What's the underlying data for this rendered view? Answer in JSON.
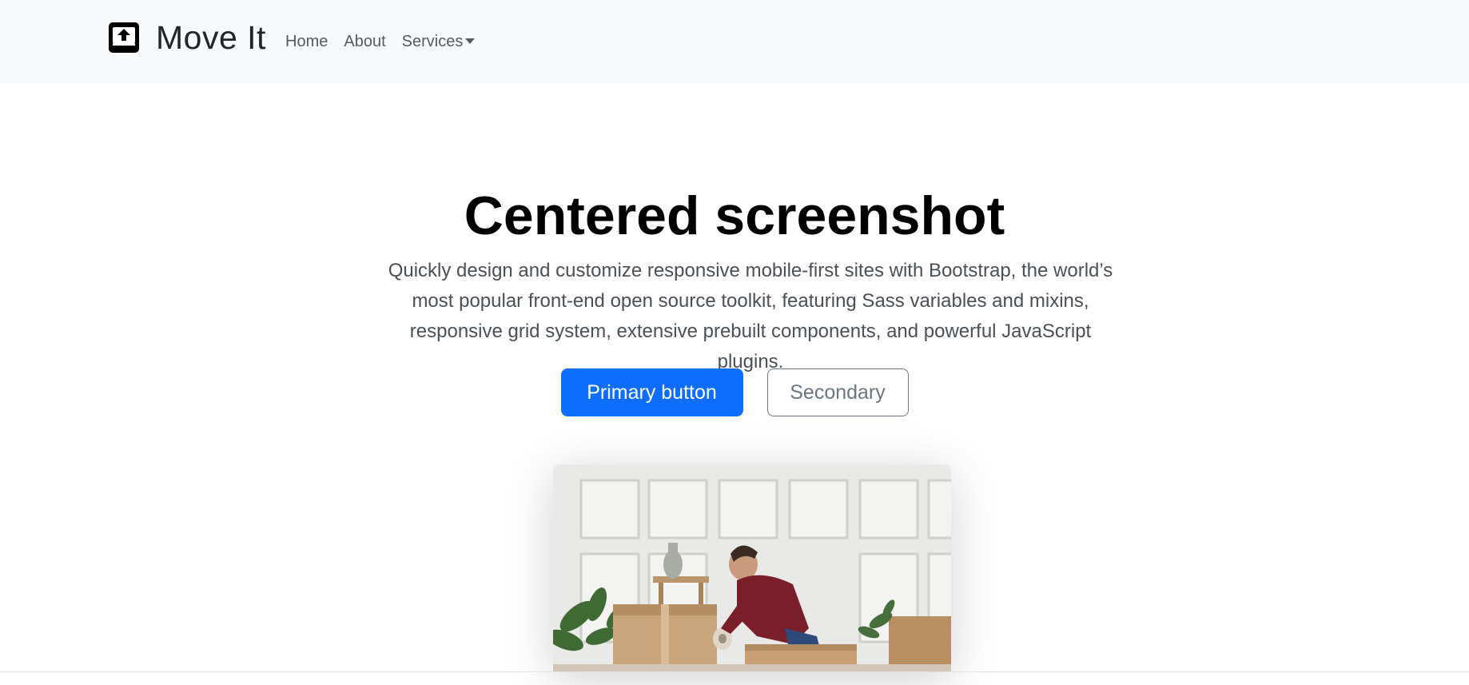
{
  "navbar": {
    "brand_name": "Move It",
    "brand_icon": "box-arrow-up-icon",
    "links": [
      {
        "label": "Home"
      },
      {
        "label": "About"
      },
      {
        "label": "Services",
        "has_dropdown": true
      }
    ]
  },
  "hero": {
    "title": "Centered screenshot",
    "lead": "Quickly design and customize responsive mobile-first sites with Bootstrap, the world’s most popular front-end open source toolkit, featuring Sass variables and mixins, responsive grid system, extensive prebuilt components, and powerful JavaScript plugins.",
    "primary_button": "Primary button",
    "secondary_button": "Secondary"
  },
  "colors": {
    "navbar_bg": "#f8f9fa",
    "primary": "#0d6efd",
    "secondary": "#6c757d"
  }
}
